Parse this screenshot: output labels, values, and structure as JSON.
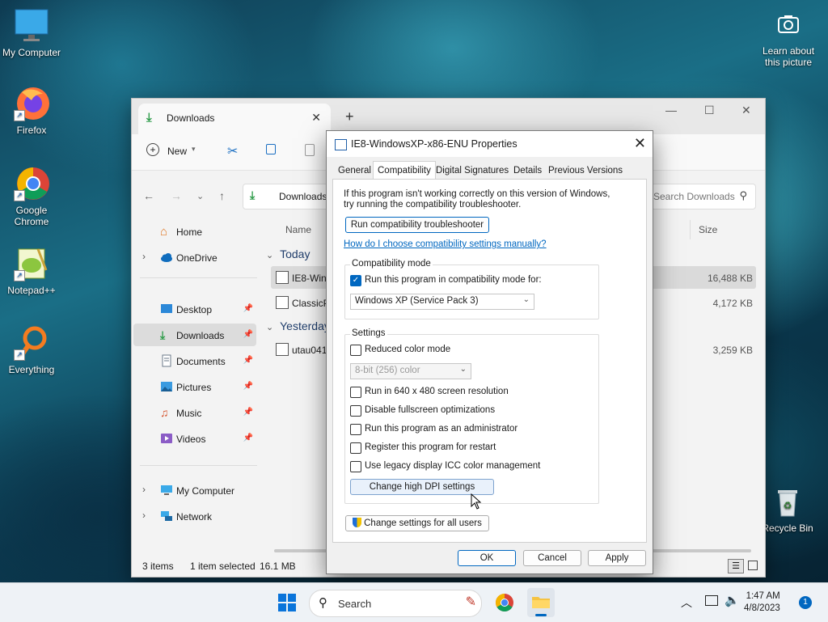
{
  "desktop": {
    "icons": [
      {
        "label": "My Computer"
      },
      {
        "label": "Firefox"
      },
      {
        "label": "Google Chrome"
      },
      {
        "label": "Notepad++"
      },
      {
        "label": "Everything"
      },
      {
        "label": "Recycle Bin"
      }
    ],
    "learn_about": "Learn about this picture"
  },
  "explorer": {
    "tab_title": "Downloads",
    "new_label": "New",
    "address": "Downloads",
    "search_placeholder": "Search Downloads",
    "column_name": "Name",
    "column_size": "Size",
    "sidebar": [
      {
        "label": "Home"
      },
      {
        "label": "OneDrive"
      },
      {
        "label": "Desktop"
      },
      {
        "label": "Downloads"
      },
      {
        "label": "Documents"
      },
      {
        "label": "Pictures"
      },
      {
        "label": "Music"
      },
      {
        "label": "Videos"
      },
      {
        "label": "My Computer"
      },
      {
        "label": "Network"
      }
    ],
    "groups": [
      {
        "label": "Today"
      },
      {
        "label": "Yesterday"
      }
    ],
    "files": [
      {
        "name": "IE8-Wind",
        "size": "16,488 KB"
      },
      {
        "name": "ClassicP",
        "size": "4,172 KB"
      },
      {
        "name": "utau041",
        "size": "3,259 KB"
      }
    ],
    "status": {
      "items": "3 items",
      "selected": "1 item selected",
      "size": "16.1 MB"
    }
  },
  "dialog": {
    "title": "IE8-WindowsXP-x86-ENU Properties",
    "tabs": [
      {
        "label": "General"
      },
      {
        "label": "Compatibility"
      },
      {
        "label": "Digital Signatures"
      },
      {
        "label": "Details"
      },
      {
        "label": "Previous Versions"
      }
    ],
    "intro_line1": "If this program isn't working correctly on this version of Windows,",
    "intro_line2": "try running the compatibility troubleshooter.",
    "troubleshooter_button": "Run compatibility troubleshooter",
    "help_link": "How do I choose compatibility settings manually?",
    "compat_group": "Compatibility mode",
    "compat_checkbox": "Run this program in compatibility mode for:",
    "compat_select": "Windows XP (Service Pack 3)",
    "settings_group": "Settings",
    "reduced_color": "Reduced color mode",
    "color_select": "8-bit (256) color",
    "options": [
      {
        "label": "Run in 640 x 480 screen resolution"
      },
      {
        "label": "Disable fullscreen optimizations"
      },
      {
        "label": "Run this program as an administrator"
      },
      {
        "label": "Register this program for restart"
      },
      {
        "label": "Use legacy display ICC color management"
      }
    ],
    "dpi_button": "Change high DPI settings",
    "all_users_button": "Change settings for all users",
    "ok": "OK",
    "cancel": "Cancel",
    "apply": "Apply"
  },
  "taskbar": {
    "search": "Search",
    "time": "1:47 AM",
    "date": "4/8/2023",
    "notifications": "1"
  },
  "colors": {
    "accent": "#0067c0",
    "link": "#0067c0"
  }
}
